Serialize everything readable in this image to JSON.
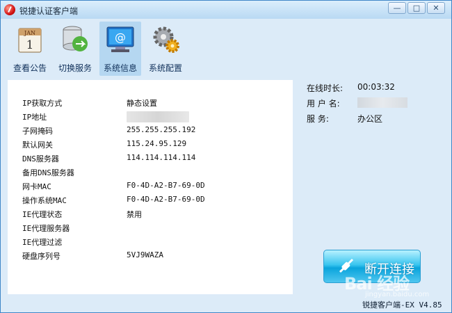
{
  "window": {
    "title": "锐捷认证客户端",
    "controls": {
      "minimize": "—",
      "maximize": "□",
      "close": "✕"
    }
  },
  "toolbar": {
    "items": [
      {
        "label": "查看公告",
        "icon": "calendar-icon"
      },
      {
        "label": "切换服务",
        "icon": "service-switch-icon"
      },
      {
        "label": "系统信息",
        "icon": "monitor-email-icon",
        "active": true
      },
      {
        "label": "系统配置",
        "icon": "gear-icon"
      }
    ]
  },
  "info": [
    {
      "label": "IP获取方式",
      "value": "静态设置"
    },
    {
      "label": "IP地址",
      "value": ""
    },
    {
      "label": "子网掩码",
      "value": "255.255.255.192"
    },
    {
      "label": "默认网关",
      "value": "115.24.95.129"
    },
    {
      "label": "DNS服务器",
      "value": "114.114.114.114"
    },
    {
      "label": "备用DNS服务器",
      "value": ""
    },
    {
      "label": "网卡MAC",
      "value": "F0-4D-A2-B7-69-0D"
    },
    {
      "label": "操作系统MAC",
      "value": "F0-4D-A2-B7-69-0D"
    },
    {
      "label": "IE代理状态",
      "value": "禁用"
    },
    {
      "label": "IE代理服务器",
      "value": ""
    },
    {
      "label": "IE代理过滤",
      "value": ""
    },
    {
      "label": "硬盘序列号",
      "value": "5VJ9WAZA"
    }
  ],
  "status": {
    "online_label": "在线时长:",
    "online_value": "00:03:32",
    "user_label": "用 户 名:",
    "user_value": "",
    "service_label": "服     务:",
    "service_value": "办公区"
  },
  "actions": {
    "disconnect_label": "断开连接"
  },
  "footer": {
    "version": "锐捷客户端-EX V4.85"
  },
  "watermark": {
    "text": "Bai 经验",
    "sub": "jingyan.baidu.com"
  }
}
